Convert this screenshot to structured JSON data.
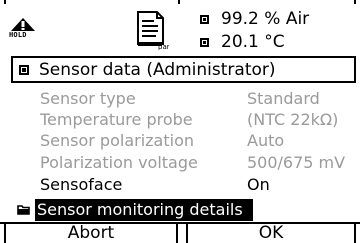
{
  "status": {
    "hold_label": "HOLD",
    "param_icon_label": "par",
    "readouts": [
      {
        "value": "99.2 % Air"
      },
      {
        "value": "20.1 °C"
      }
    ]
  },
  "menu": {
    "title": "Sensor data (Administrator)",
    "rows": [
      {
        "label": "Sensor type",
        "value": "Standard",
        "enabled": false
      },
      {
        "label": "Temperature probe",
        "value": "(NTC 22kΩ)",
        "enabled": false
      },
      {
        "label": "Sensor polarization",
        "value": "Auto",
        "enabled": false
      },
      {
        "label": "Polarization voltage",
        "value": "500/675 mV",
        "enabled": false
      },
      {
        "label": "Sensoface",
        "value": "On",
        "enabled": true
      }
    ],
    "selected_item": "Sensor monitoring details"
  },
  "softkeys": {
    "left": "Abort",
    "right": "OK"
  },
  "colors": {
    "disabled_text": "#9a9a9a",
    "foreground": "#000000",
    "background": "#ffffff"
  }
}
